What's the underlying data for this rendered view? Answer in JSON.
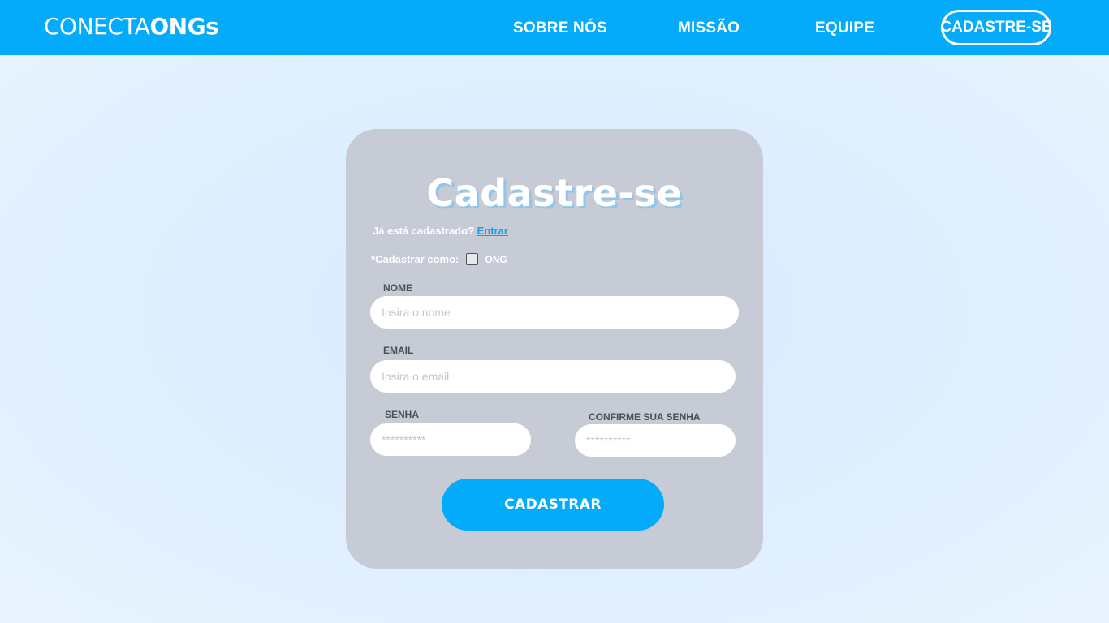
{
  "header": {
    "logo_light": "CONECTA",
    "logo_bold": "ONGs",
    "nav": {
      "about": "SOBRE NÓS",
      "mission": "MISSÃO",
      "team": "EQUIPE",
      "signup": "CADASTRE-SE"
    },
    "bar_color": "#03abfa"
  },
  "form": {
    "title": "Cadastre-se",
    "already_text": "Já está cadastrado?",
    "login_link": "Entrar",
    "role_label": "*Cadastrar como:",
    "role_option": "ONG",
    "role_checked": false,
    "name": {
      "label": "NOME",
      "placeholder": "Insira o nome",
      "value": ""
    },
    "email": {
      "label": "EMAIL",
      "placeholder": "Insira o email",
      "value": ""
    },
    "password": {
      "label": "SENHA",
      "placeholder": "**********",
      "value": ""
    },
    "confirm": {
      "label": "CONFIRME SUA SENHA",
      "placeholder": "**********",
      "value": ""
    },
    "submit_label": "CADASTRAR",
    "card_color": "#c6cbd5",
    "accent_color": "#03abfa"
  }
}
